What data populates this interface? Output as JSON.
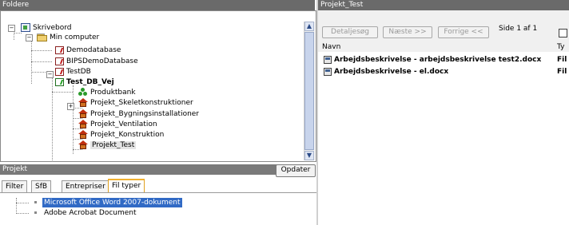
{
  "left_panel": {
    "title": "Foldere",
    "tree": [
      {
        "label": "Skrivebord",
        "icon": "desktop-icon",
        "bold": false
      },
      {
        "label": "Min computer",
        "icon": "folder-icon",
        "bold": false
      },
      {
        "label": "Demodatabase",
        "icon": "database-icon",
        "bold": false
      },
      {
        "label": "BIPSDemoDatabase",
        "icon": "database-icon",
        "bold": false
      },
      {
        "label": "TestDB",
        "icon": "database-icon",
        "bold": false
      },
      {
        "label": "Test_DB_Vej",
        "icon": "database-green-icon",
        "bold": true
      },
      {
        "label": "Produktbank",
        "icon": "people-icon",
        "bold": false
      },
      {
        "label": "Projekt_Skeletkonstruktioner",
        "icon": "house-icon",
        "bold": false
      },
      {
        "label": "Projekt_Bygningsinstallationer",
        "icon": "house-icon",
        "bold": false
      },
      {
        "label": "Projekt_Ventilation",
        "icon": "house-icon",
        "bold": false
      },
      {
        "label": "Projekt_Konstruktion",
        "icon": "house-icon",
        "bold": false
      },
      {
        "label": "Projekt_Test",
        "icon": "house-icon",
        "bold": false,
        "selected": true
      }
    ]
  },
  "project_panel": {
    "title": "Projekt",
    "update_button": "Opdater",
    "tabs": [
      "Filter",
      "SfB",
      "Entrepriser",
      "Fil typer"
    ],
    "active_tab": "Fil typer",
    "file_types": [
      {
        "label": "Microsoft Office Word 2007-dokument",
        "selected": true
      },
      {
        "label": "Adobe Acrobat Document",
        "selected": false
      }
    ],
    "highlight_color": "#316ac5"
  },
  "right_panel": {
    "title": "Projekt_Test",
    "buttons": {
      "detail": "Detaljesøg",
      "next": "Næste >>",
      "prev": "Forrige <<"
    },
    "page_info": "Side 1 af 1",
    "columns": [
      "Navn",
      "Ty"
    ],
    "files": [
      {
        "name": "Arbejdsbeskrivelse - arbejdsbeskrivelse test2.docx",
        "type": "Fil"
      },
      {
        "name": "Arbejdsbeskrivelse - el.docx",
        "type": "Fil"
      }
    ]
  },
  "colors": {
    "titlebar": "#6a6a6a",
    "tab_accent": "#f0b030"
  }
}
